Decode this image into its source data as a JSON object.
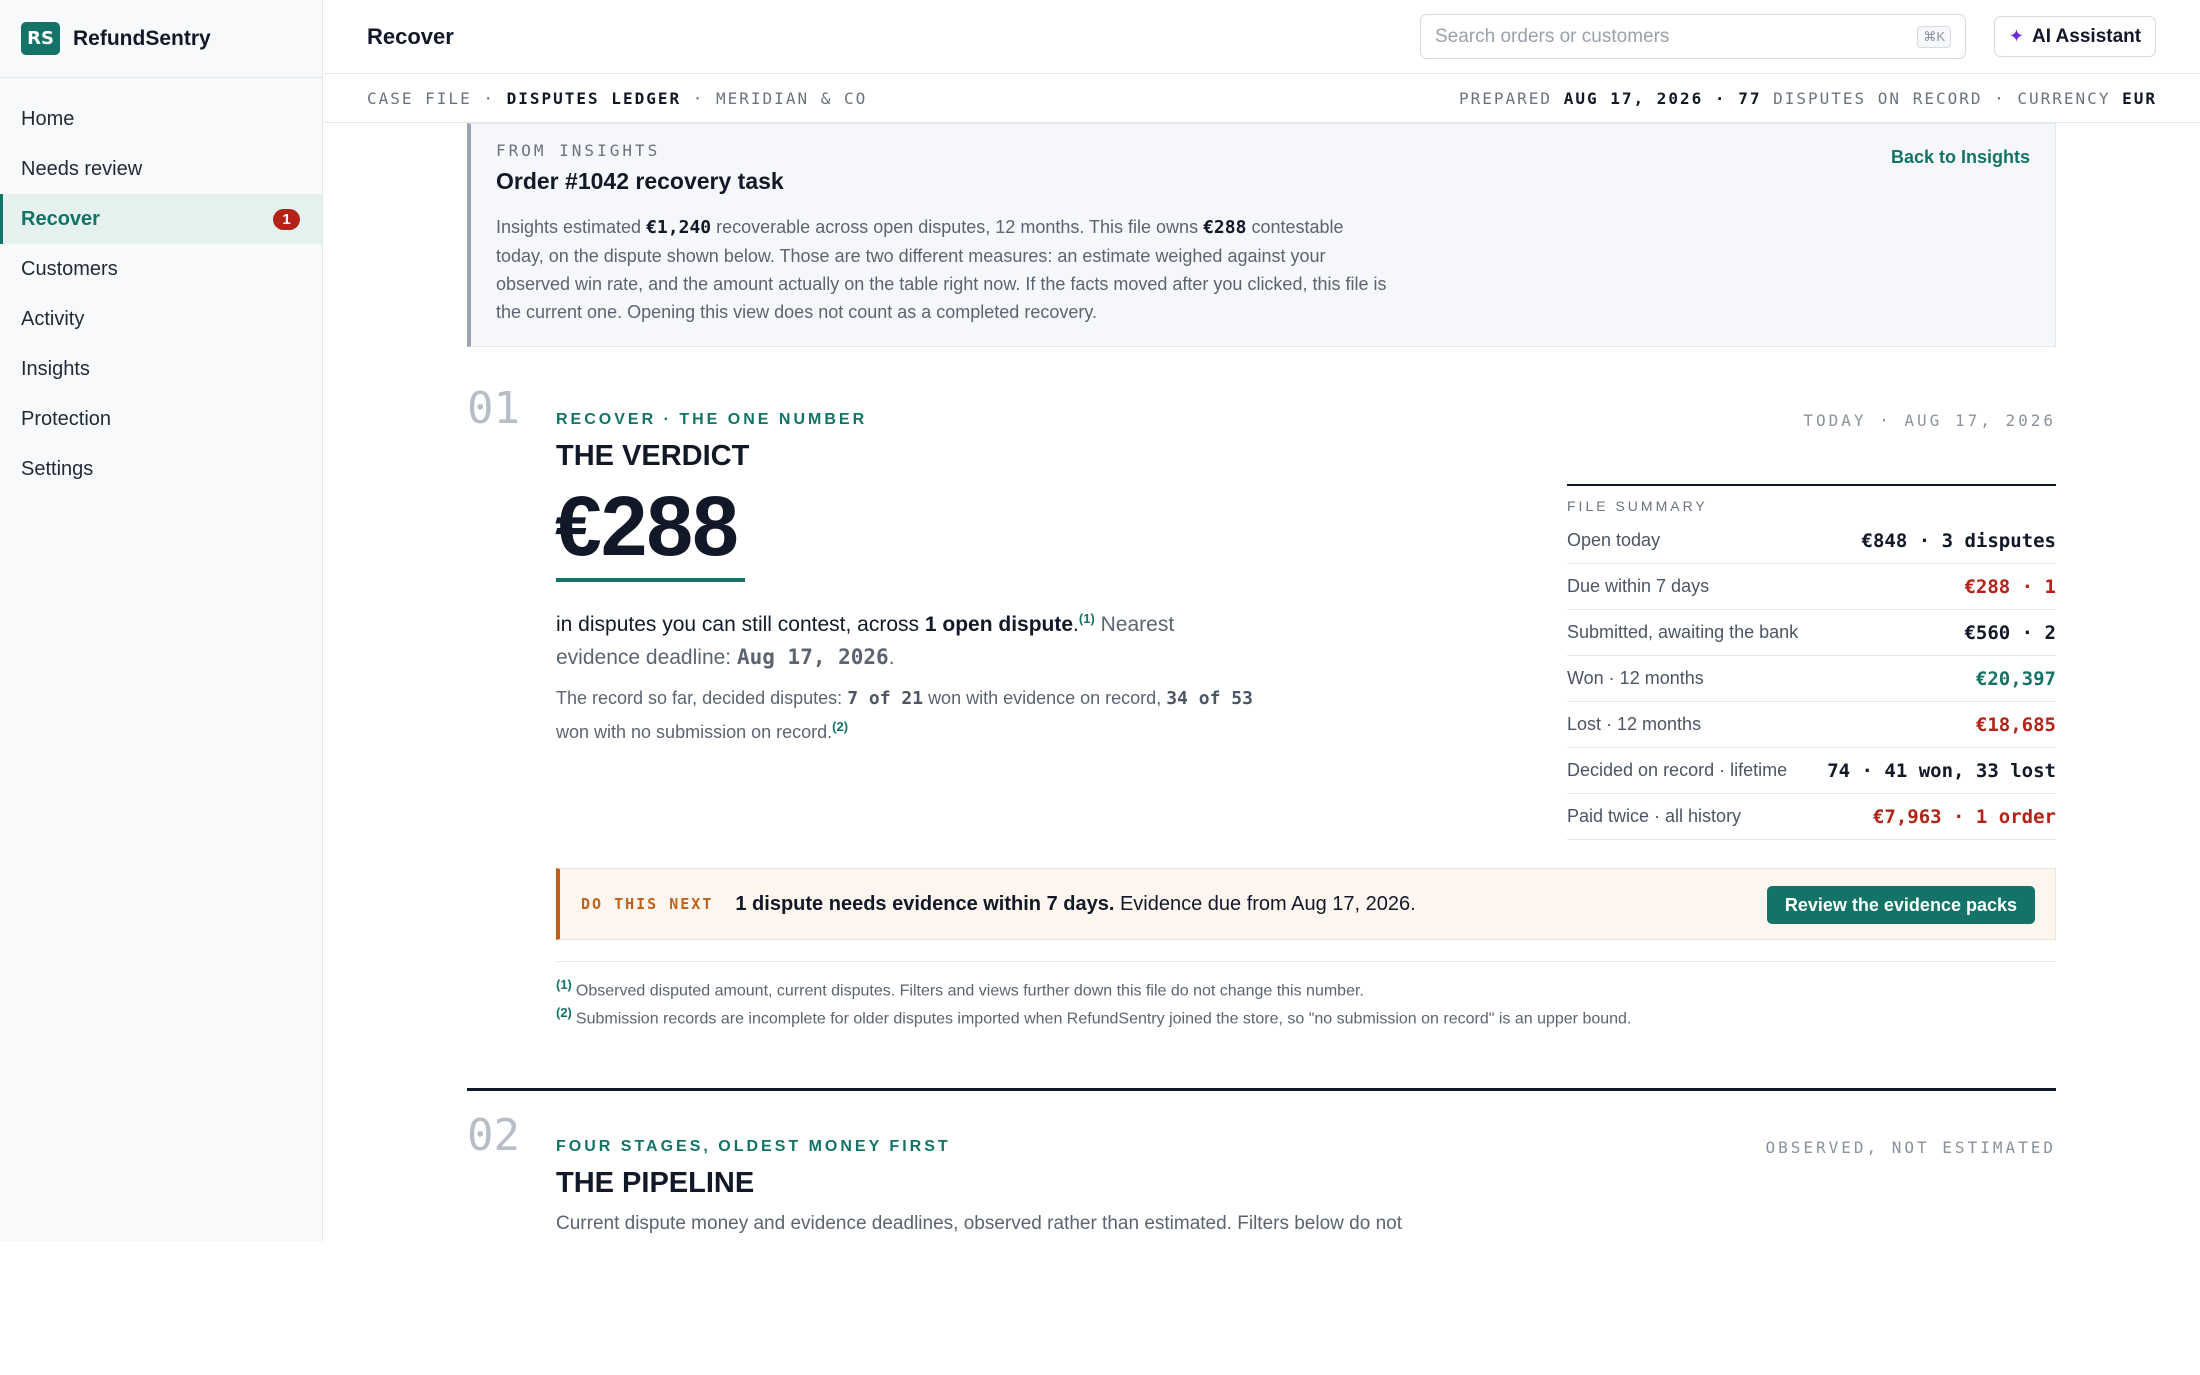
{
  "brand": {
    "logo": "RS",
    "name": "RefundSentry"
  },
  "sidebar": {
    "items": [
      {
        "label": "Home"
      },
      {
        "label": "Needs review"
      },
      {
        "label": "Recover",
        "badge": "1",
        "active": true
      },
      {
        "label": "Customers"
      },
      {
        "label": "Activity"
      },
      {
        "label": "Insights"
      },
      {
        "label": "Protection"
      },
      {
        "label": "Settings"
      }
    ]
  },
  "header": {
    "title": "Recover",
    "search_placeholder": "Search orders or customers",
    "search_shortcut": "⌘K",
    "ai_label": "AI Assistant"
  },
  "casebar": {
    "prefix": "CASE FILE ·",
    "ledger": "DISPUTES LEDGER",
    "store": "· MERIDIAN & CO",
    "prepared_label": "PREPARED",
    "prepared_date": "AUG 17, 2026",
    "disputes_count": "· 77",
    "disputes_label": "DISPUTES ON RECORD · CURRENCY",
    "currency": "EUR"
  },
  "insights": {
    "eyebrow": "FROM INSIGHTS",
    "title": "Order #1042 recovery task",
    "body_1": "Insights estimated",
    "estimate": "€1,240",
    "body_2": "recoverable across open disputes, 12 months. This file owns",
    "owned": "€288",
    "body_3": "contestable today, on the dispute shown below. Those are two different measures: an estimate weighed against your observed win rate, and the amount actually on the table right now. If the facts moved after you clicked, this file is the current one. Opening this view does not count as a completed recovery.",
    "back_link": "Back to Insights"
  },
  "verdict": {
    "num": "01",
    "eyebrow": "RECOVER · THE ONE NUMBER",
    "date_right": "TODAY · AUG 17, 2026",
    "title": "THE VERDICT",
    "amount": "€288",
    "lede_1": "in disputes you can still contest, across",
    "lede_bold": "1 open dispute",
    "lede_2": ".",
    "fn1_mark": "(1)",
    "lede_3": "Nearest evidence deadline:",
    "deadline": "Aug 17, 2026",
    "record_1": "The record so far, decided disputes:",
    "record_won_ev": "7 of 21",
    "record_2": "won with evidence on record,",
    "record_won_none": "34 of 53",
    "record_3": "won with no submission on record.",
    "fn2_mark": "(2)"
  },
  "summary": {
    "heading": "FILE SUMMARY",
    "rows": [
      {
        "label": "Open today",
        "value": "€848 · 3 disputes",
        "tone": "dark"
      },
      {
        "label": "Due within 7 days",
        "value": "€288 · 1",
        "tone": "red"
      },
      {
        "label": "Submitted, awaiting the bank",
        "value": "€560 · 2",
        "tone": "dark"
      },
      {
        "label": "Won · 12 months",
        "value": "€20,397",
        "tone": "green"
      },
      {
        "label": "Lost · 12 months",
        "value": "€18,685",
        "tone": "red"
      },
      {
        "label": "Decided on record · lifetime",
        "value": "74 · 41 won, 33 lost",
        "tone": "dark"
      },
      {
        "label": "Paid twice · all history",
        "value": "€7,963 · 1 order",
        "tone": "red"
      }
    ]
  },
  "next": {
    "tag": "DO THIS NEXT",
    "bold": "1 dispute needs evidence within 7 days.",
    "rest": "Evidence due from Aug 17, 2026.",
    "button": "Review the evidence packs"
  },
  "footnotes": [
    {
      "mark": "(1)",
      "text": "Observed disputed amount, current disputes. Filters and views further down this file do not change this number."
    },
    {
      "mark": "(2)",
      "text": "Submission records are incomplete for older disputes imported when RefundSentry joined the store, so \"no submission on record\" is an upper bound."
    }
  ],
  "pipeline": {
    "num": "02",
    "eyebrow": "FOUR STAGES, OLDEST MONEY FIRST",
    "right": "OBSERVED, NOT ESTIMATED",
    "title": "THE PIPELINE",
    "desc": "Current dispute money and evidence deadlines, observed rather than estimated. Filters below do not"
  },
  "colors": {
    "accent": "#137366",
    "danger": "#b42318",
    "warning": "#c2611a",
    "ai": "#6d28d9"
  },
  "icons": {
    "ai": "sparkle-icon"
  }
}
